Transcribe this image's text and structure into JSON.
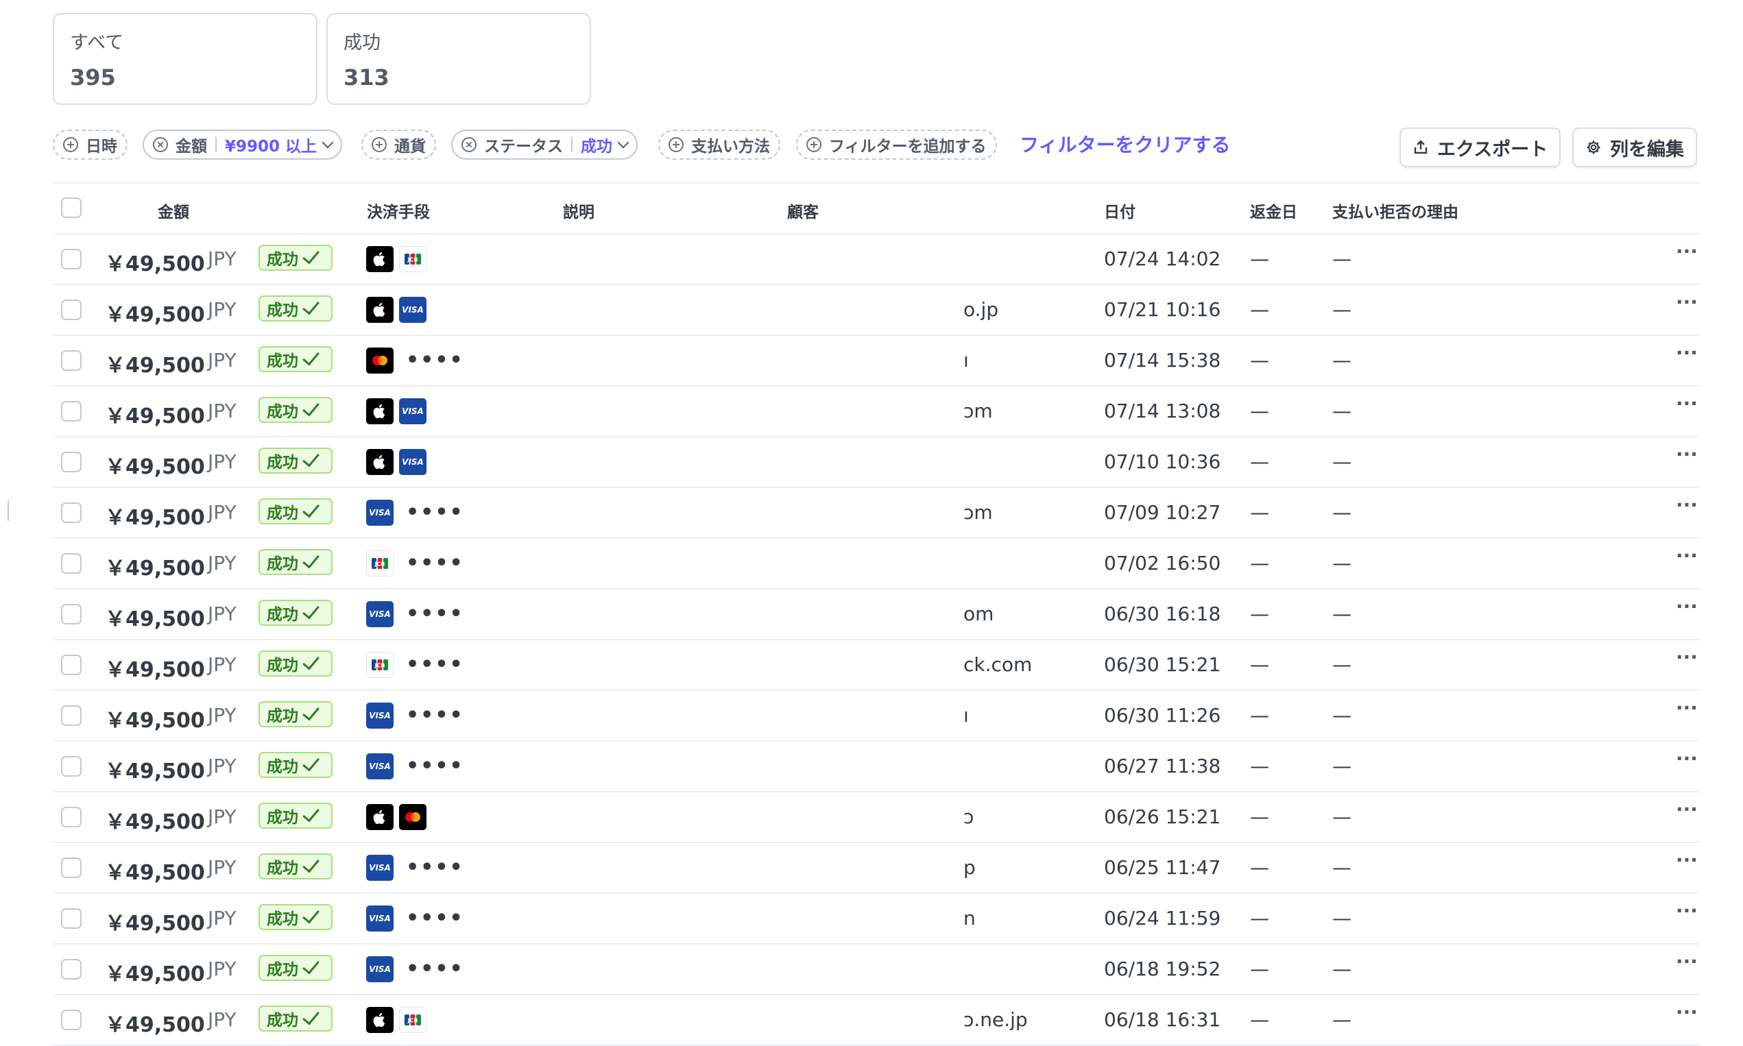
{
  "summary_cards": [
    {
      "label": "すべて",
      "count": "395"
    },
    {
      "label": "成功",
      "count": "313"
    }
  ],
  "filters": {
    "date": "日時",
    "amount": "金額",
    "amount_value": "¥9900 以上",
    "currency": "通貨",
    "status": "ステータス",
    "status_value": "成功",
    "payment_method": "支払い方法",
    "add_filter": "フィルターを追加する",
    "clear": "フィルターをクリアする"
  },
  "toolbar": {
    "export": "エクスポート",
    "edit_columns": "列を編集"
  },
  "columns": {
    "amount": "金額",
    "payment_method": "決済手段",
    "description": "説明",
    "customer": "顧客",
    "date": "日付",
    "refund_date": "返金日",
    "dispute_reason": "支払い拒否の理由"
  },
  "colors": {
    "accent": "#635bff",
    "success_bg": "#ecfbe2",
    "success_text": "#2b7d1e",
    "visa": "#1a4aa3"
  },
  "rows": [
    {
      "amount": "￥49,500",
      "currency": "JPY",
      "status": "成功",
      "methods": [
        "apple-pay-icon",
        "jcb-icon"
      ],
      "masked": "",
      "customer": "",
      "date": "07/24 14:02",
      "refund": "—",
      "dispute": "—",
      "more": "···"
    },
    {
      "amount": "￥49,500",
      "currency": "JPY",
      "status": "成功",
      "methods": [
        "apple-pay-icon",
        "visa-icon"
      ],
      "masked": "",
      "customer": "o.jp",
      "date": "07/21 10:16",
      "refund": "—",
      "dispute": "—",
      "more": "···"
    },
    {
      "amount": "￥49,500",
      "currency": "JPY",
      "status": "成功",
      "methods": [
        "mastercard-icon"
      ],
      "masked": "••••",
      "customer": "ı",
      "date": "07/14 15:38",
      "refund": "—",
      "dispute": "—",
      "more": "···"
    },
    {
      "amount": "￥49,500",
      "currency": "JPY",
      "status": "成功",
      "methods": [
        "apple-pay-icon",
        "visa-icon"
      ],
      "masked": "",
      "customer": "ɔm",
      "date": "07/14 13:08",
      "refund": "—",
      "dispute": "—",
      "more": "···"
    },
    {
      "amount": "￥49,500",
      "currency": "JPY",
      "status": "成功",
      "methods": [
        "apple-pay-icon",
        "visa-icon"
      ],
      "masked": "",
      "customer": "",
      "date": "07/10 10:36",
      "refund": "—",
      "dispute": "—",
      "more": "···"
    },
    {
      "amount": "￥49,500",
      "currency": "JPY",
      "status": "成功",
      "methods": [
        "visa-icon"
      ],
      "masked": "••••",
      "customer": "ɔm",
      "date": "07/09 10:27",
      "refund": "—",
      "dispute": "—",
      "more": "···"
    },
    {
      "amount": "￥49,500",
      "currency": "JPY",
      "status": "成功",
      "methods": [
        "jcb-icon"
      ],
      "masked": "••••",
      "customer": "",
      "date": "07/02 16:50",
      "refund": "—",
      "dispute": "—",
      "more": "···"
    },
    {
      "amount": "￥49,500",
      "currency": "JPY",
      "status": "成功",
      "methods": [
        "visa-icon"
      ],
      "masked": "••••",
      "customer": "om",
      "date": "06/30 16:18",
      "refund": "—",
      "dispute": "—",
      "more": "···"
    },
    {
      "amount": "￥49,500",
      "currency": "JPY",
      "status": "成功",
      "methods": [
        "jcb-icon"
      ],
      "masked": "••••",
      "customer": "ck.com",
      "date": "06/30 15:21",
      "refund": "—",
      "dispute": "—",
      "more": "···"
    },
    {
      "amount": "￥49,500",
      "currency": "JPY",
      "status": "成功",
      "methods": [
        "visa-icon"
      ],
      "masked": "••••",
      "customer": "ı",
      "date": "06/30 11:26",
      "refund": "—",
      "dispute": "—",
      "more": "···"
    },
    {
      "amount": "￥49,500",
      "currency": "JPY",
      "status": "成功",
      "methods": [
        "visa-icon"
      ],
      "masked": "••••",
      "customer": "",
      "date": "06/27 11:38",
      "refund": "—",
      "dispute": "—",
      "more": "···"
    },
    {
      "amount": "￥49,500",
      "currency": "JPY",
      "status": "成功",
      "methods": [
        "apple-pay-icon",
        "mastercard-icon"
      ],
      "masked": "",
      "customer": "ɔ",
      "date": "06/26 15:21",
      "refund": "—",
      "dispute": "—",
      "more": "···"
    },
    {
      "amount": "￥49,500",
      "currency": "JPY",
      "status": "成功",
      "methods": [
        "visa-icon"
      ],
      "masked": "••••",
      "customer": "p",
      "date": "06/25 11:47",
      "refund": "—",
      "dispute": "—",
      "more": "···"
    },
    {
      "amount": "￥49,500",
      "currency": "JPY",
      "status": "成功",
      "methods": [
        "visa-icon"
      ],
      "masked": "••••",
      "customer": "n",
      "date": "06/24 11:59",
      "refund": "—",
      "dispute": "—",
      "more": "···"
    },
    {
      "amount": "￥49,500",
      "currency": "JPY",
      "status": "成功",
      "methods": [
        "visa-icon"
      ],
      "masked": "••••",
      "customer": "",
      "date": "06/18 19:52",
      "refund": "—",
      "dispute": "—",
      "more": "···"
    },
    {
      "amount": "￥49,500",
      "currency": "JPY",
      "status": "成功",
      "methods": [
        "apple-pay-icon",
        "jcb-icon"
      ],
      "masked": "",
      "customer": "ɔ.ne.jp",
      "date": "06/18 16:31",
      "refund": "—",
      "dispute": "—",
      "more": "···"
    }
  ]
}
